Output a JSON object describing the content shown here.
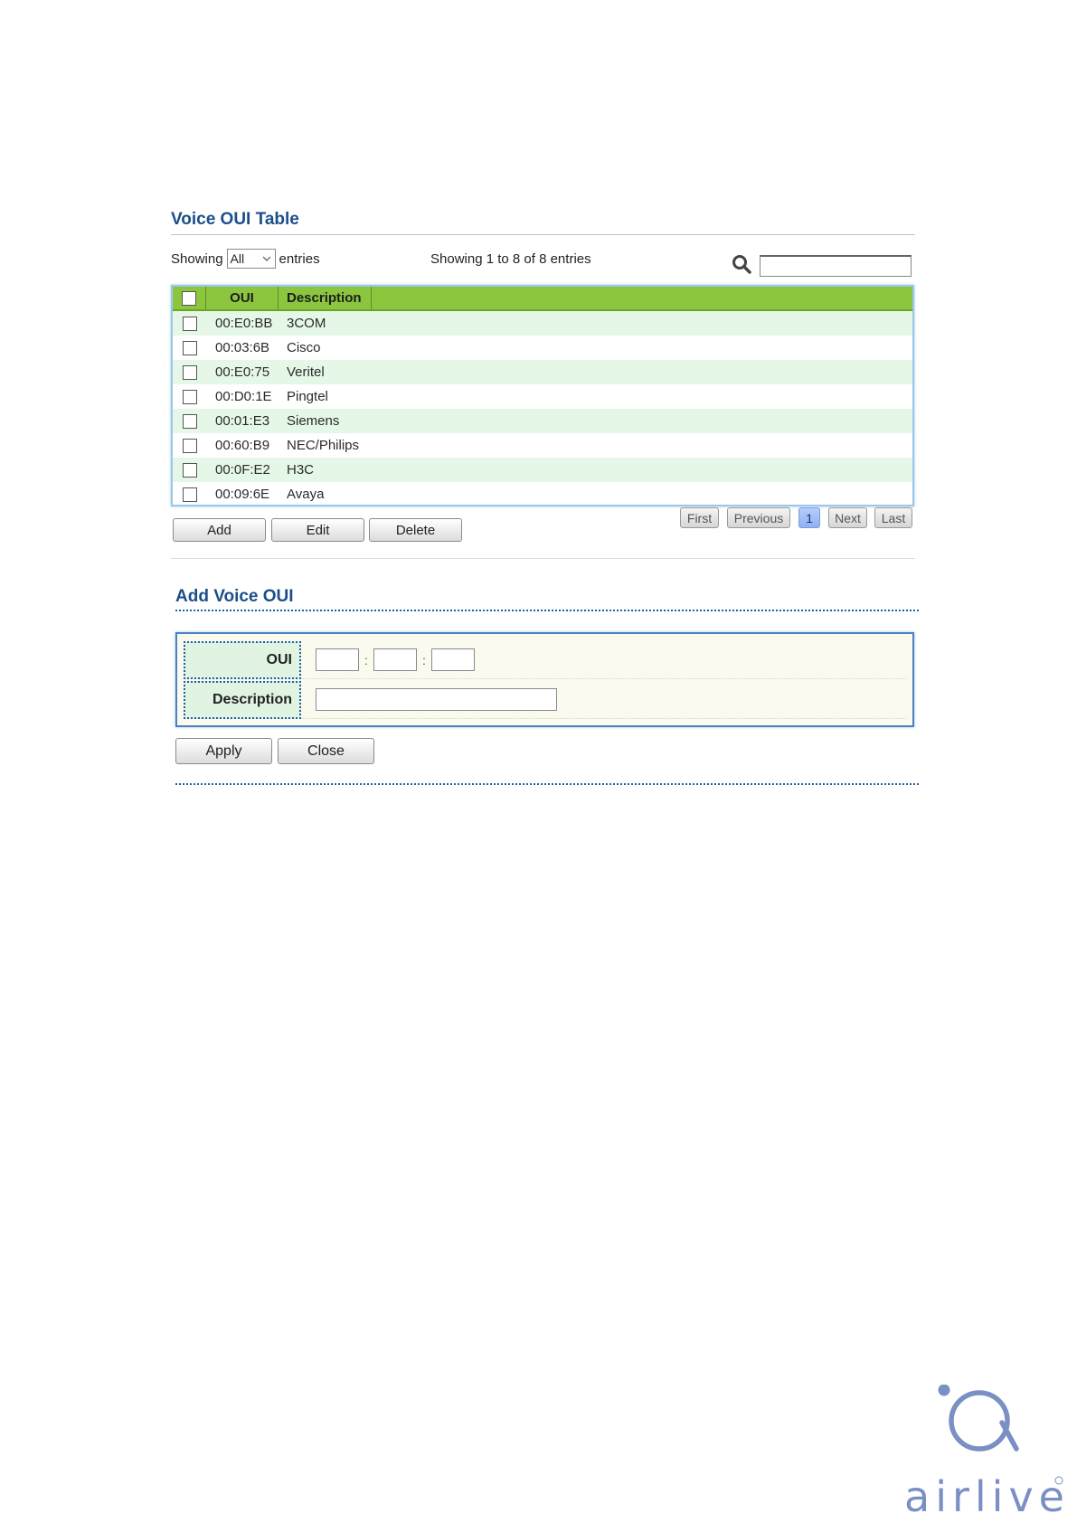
{
  "voice_oui_table": {
    "title": "Voice OUI Table",
    "showing_label": "Showing",
    "page_size": "All",
    "entries_label": "entries",
    "showing_info": "Showing 1 to 8 of 8 entries",
    "search_value": "",
    "columns": [
      "OUI",
      "Description"
    ],
    "rows": [
      {
        "oui": "00:E0:BB",
        "description": "3COM"
      },
      {
        "oui": "00:03:6B",
        "description": "Cisco"
      },
      {
        "oui": "00:E0:75",
        "description": "Veritel"
      },
      {
        "oui": "00:D0:1E",
        "description": "Pingtel"
      },
      {
        "oui": "00:01:E3",
        "description": "Siemens"
      },
      {
        "oui": "00:60:B9",
        "description": "NEC/Philips"
      },
      {
        "oui": "00:0F:E2",
        "description": "H3C"
      },
      {
        "oui": "00:09:6E",
        "description": "Avaya"
      }
    ],
    "buttons": {
      "add": "Add",
      "edit": "Edit",
      "delete": "Delete"
    },
    "pagination": {
      "first": "First",
      "previous": "Previous",
      "current": "1",
      "next": "Next",
      "last": "Last"
    }
  },
  "add_voice_oui": {
    "title": "Add Voice OUI",
    "oui_label": "OUI",
    "oui_octets": [
      "",
      "",
      ""
    ],
    "oui_separator": ":",
    "description_label": "Description",
    "description_value": "",
    "apply": "Apply",
    "close": "Close"
  },
  "logo": {
    "brand": "airlive"
  },
  "colors": {
    "title_blue": "#1b4f8a",
    "header_green": "#8cc63f",
    "row_alt": "#e5f7e6",
    "active_page": "#9ab8f5",
    "logo_blue": "#7a8fc4"
  }
}
